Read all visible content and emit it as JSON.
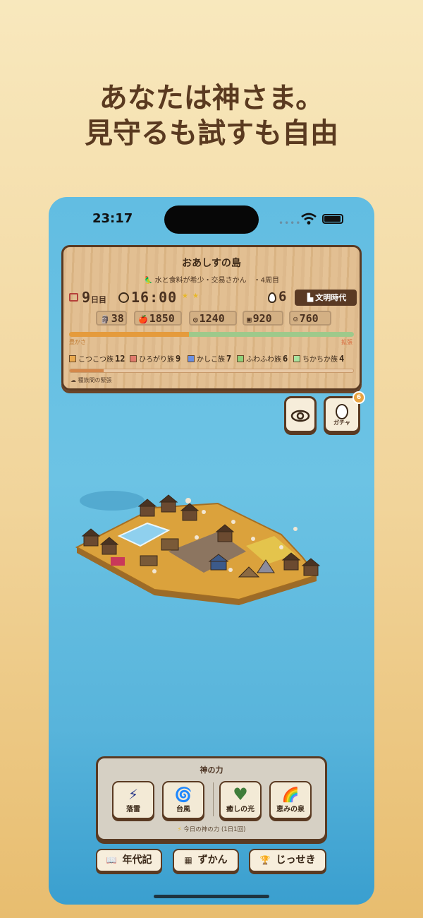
{
  "headline": {
    "line1": "あなたは神さま。",
    "line2": "見守るも試すも自由"
  },
  "status_bar": {
    "time": "23:17",
    "dots": "••••"
  },
  "island": {
    "name": "おあしすの島",
    "condition": "水と食料が希少・交易さかん　・4周目",
    "condition_icon": "🦜",
    "day_number": "9",
    "day_label": "日目",
    "clock": "16:00",
    "stars": "★★",
    "eggs": "6",
    "era": "文明時代",
    "resources": [
      {
        "icon": "people-icon",
        "glyph": "🗿",
        "value": "38"
      },
      {
        "icon": "apple-icon",
        "glyph": "🍎",
        "value": "1850"
      },
      {
        "icon": "coin-icon",
        "glyph": "◎",
        "value": "1240"
      },
      {
        "icon": "book-icon",
        "glyph": "▣",
        "value": "920"
      },
      {
        "icon": "faith-icon",
        "glyph": "☺",
        "value": "760"
      }
    ],
    "prosperity_label": "豊かさ",
    "expansion_label": "拡張",
    "prosperity_fraction": 0.42,
    "tribes": [
      {
        "name": "こつこつ族",
        "count": "12",
        "color": "#e9a94f"
      },
      {
        "name": "ひろがり族",
        "count": "9",
        "color": "#e07a6c"
      },
      {
        "name": "かしこ族",
        "count": "7",
        "color": "#6b8fe0"
      },
      {
        "name": "ふわふわ族",
        "count": "6",
        "color": "#8fd07a"
      },
      {
        "name": "ちかちか族",
        "count": "4",
        "color": "#a8e3a0"
      }
    ],
    "tension_fraction": 0.12,
    "tension_label": "種族間の緊張",
    "tension_icon": "☁"
  },
  "side_buttons": {
    "gacha_label": "ガチャ",
    "gacha_badge": "6"
  },
  "god_powers": {
    "title": "神の力",
    "powers": [
      {
        "label": "落雷",
        "icon": "lightning-icon",
        "glyph": "⚡",
        "color": "#2b3a8a"
      },
      {
        "label": "台風",
        "icon": "typhoon-icon",
        "glyph": "🌀",
        "color": "#2e9bd6"
      },
      {
        "label": "癒しの光",
        "icon": "heart-icon",
        "glyph": "♥",
        "color": "#3f7d3a"
      },
      {
        "label": "恵みの泉",
        "icon": "rainbow-icon",
        "glyph": "🌈",
        "color": "#e06d4c"
      }
    ],
    "footer": "今日の神の力 (1日1回)",
    "footer_icon": "⚡"
  },
  "nav": [
    {
      "label": "年代記",
      "icon": "book-icon",
      "glyph": "📖"
    },
    {
      "label": "ずかん",
      "icon": "grid-icon",
      "glyph": "▦"
    },
    {
      "label": "じっせき",
      "icon": "trophy-icon",
      "glyph": "🏆"
    }
  ]
}
